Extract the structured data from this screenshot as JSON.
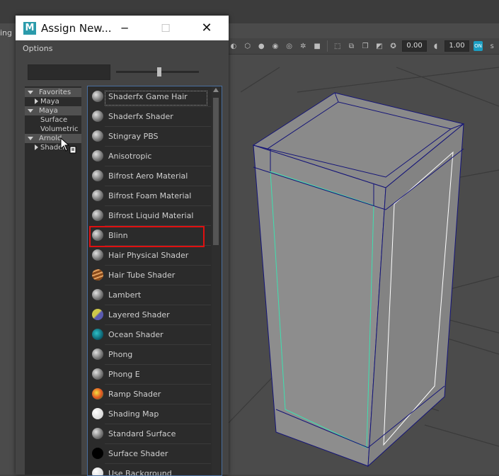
{
  "menu": {
    "fragment": "ing"
  },
  "toolbar": {
    "field_1": "0.00",
    "field_2": "1.00",
    "badge": "s",
    "on_badge": "ON"
  },
  "dialog": {
    "title": "Assign New...",
    "minimize_icon": "minimize-icon",
    "maximize_icon": "maximize-icon",
    "close_icon": "close-icon",
    "options": "Options",
    "search": {
      "value": "",
      "placeholder": ""
    },
    "slider": {
      "value": 0.52
    }
  },
  "tree": {
    "items": [
      {
        "label": "Favorites",
        "level": 0,
        "expanded": true
      },
      {
        "label": "Maya",
        "level": 1,
        "expanded": false
      },
      {
        "label": "Maya",
        "level": 0,
        "expanded": true
      },
      {
        "label": "Surface",
        "level": 1
      },
      {
        "label": "Volumetric",
        "level": 1
      },
      {
        "label": "Arnold",
        "level": 0,
        "expanded": true
      },
      {
        "label": "Shader",
        "level": 1,
        "expanded": false
      }
    ]
  },
  "list": {
    "selected": "Blinn",
    "items": [
      {
        "label": "Shaderfx Game Hair",
        "icon": "sphere-gray-icon"
      },
      {
        "label": "Shaderfx Shader",
        "icon": "sphere-gray-icon"
      },
      {
        "label": "Stingray PBS",
        "icon": "sphere-gray-icon"
      },
      {
        "label": "Anisotropic",
        "icon": "sphere-gray-icon"
      },
      {
        "label": "Bifrost Aero Material",
        "icon": "sphere-gray-icon"
      },
      {
        "label": "Bifrost Foam Material",
        "icon": "sphere-gray-icon"
      },
      {
        "label": "Bifrost Liquid Material",
        "icon": "sphere-gray-icon"
      },
      {
        "label": "Blinn",
        "icon": "sphere-gray-icon"
      },
      {
        "label": "Hair Physical Shader",
        "icon": "sphere-gray-icon"
      },
      {
        "label": "Hair Tube Shader",
        "icon": "sphere-orange-icon"
      },
      {
        "label": "Lambert",
        "icon": "sphere-gray-icon"
      },
      {
        "label": "Layered Shader",
        "icon": "sphere-layered-icon"
      },
      {
        "label": "Ocean Shader",
        "icon": "sphere-ocean-icon"
      },
      {
        "label": "Phong",
        "icon": "sphere-gray-icon"
      },
      {
        "label": "Phong E",
        "icon": "sphere-gray-icon"
      },
      {
        "label": "Ramp Shader",
        "icon": "sphere-ramp-icon"
      },
      {
        "label": "Shading Map",
        "icon": "sphere-white-icon"
      },
      {
        "label": "Standard Surface",
        "icon": "sphere-gray-icon"
      },
      {
        "label": "Surface Shader",
        "icon": "sphere-black-icon"
      },
      {
        "label": "Use Background",
        "icon": "sphere-white-icon"
      }
    ]
  },
  "colors": {
    "highlight": "#e01010",
    "list_border": "#4a6fa0",
    "wire": "#141478",
    "edge_selected": "#3ee0b0"
  }
}
